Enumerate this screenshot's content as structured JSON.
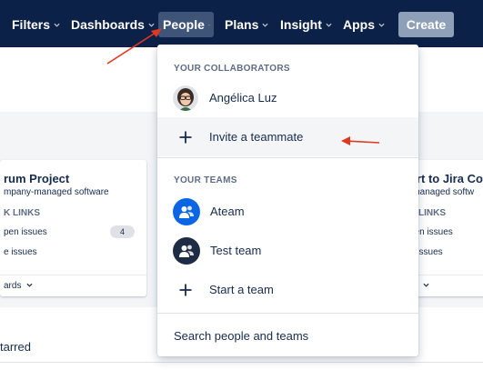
{
  "nav": {
    "items": [
      {
        "label": "Filters"
      },
      {
        "label": "Dashboards"
      },
      {
        "label": "People"
      },
      {
        "label": "Plans"
      },
      {
        "label": "Insight"
      },
      {
        "label": "Apps"
      }
    ],
    "create_label": "Create"
  },
  "background": {
    "left_card": {
      "title": "rum Project",
      "subtitle": "mpany-managed software",
      "quick_links": "K LINKS",
      "line1": "pen issues",
      "line1_count": "4",
      "line2": "e issues",
      "footer": "ards"
    },
    "right_card": {
      "title": "ort to Jira Co",
      "subtitle": "-managed softw",
      "quick_links": "K LINKS",
      "line1": "pen issues",
      "line2": "e issues",
      "footer": "rd"
    },
    "starred": "tarred"
  },
  "dropdown": {
    "collaborators_heading": "YOUR COLLABORATORS",
    "collaborator_name": "Angélica Luz",
    "invite_label": "Invite a teammate",
    "teams_heading": "YOUR TEAMS",
    "teams": [
      {
        "name": "Ateam",
        "color": "#0c66e4"
      },
      {
        "name": "Test team",
        "color": "#1d2b44"
      }
    ],
    "start_team_label": "Start a team",
    "search_label": "Search people and teams"
  },
  "colors": {
    "nav_bg": "#0b2147",
    "annotation_arrow": "#e03a1e"
  }
}
